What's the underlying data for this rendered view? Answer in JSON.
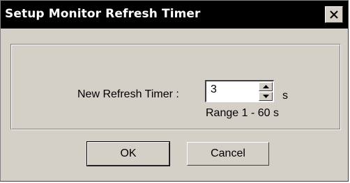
{
  "window": {
    "title": "Setup Monitor Refresh Timer"
  },
  "form": {
    "refresh_label": "New Refresh Timer :",
    "refresh_value": "3",
    "unit": "s",
    "range_text": "Range 1 - 60 s"
  },
  "buttons": {
    "ok_label": "OK",
    "cancel_label": "Cancel"
  },
  "icons": {
    "close": "close-icon",
    "spin_up": "arrow-up-icon",
    "spin_down": "arrow-down-icon"
  },
  "colors": {
    "titlebar": "#000000",
    "title_text": "#ffffff",
    "dialog_face": "#d4d0c8"
  }
}
